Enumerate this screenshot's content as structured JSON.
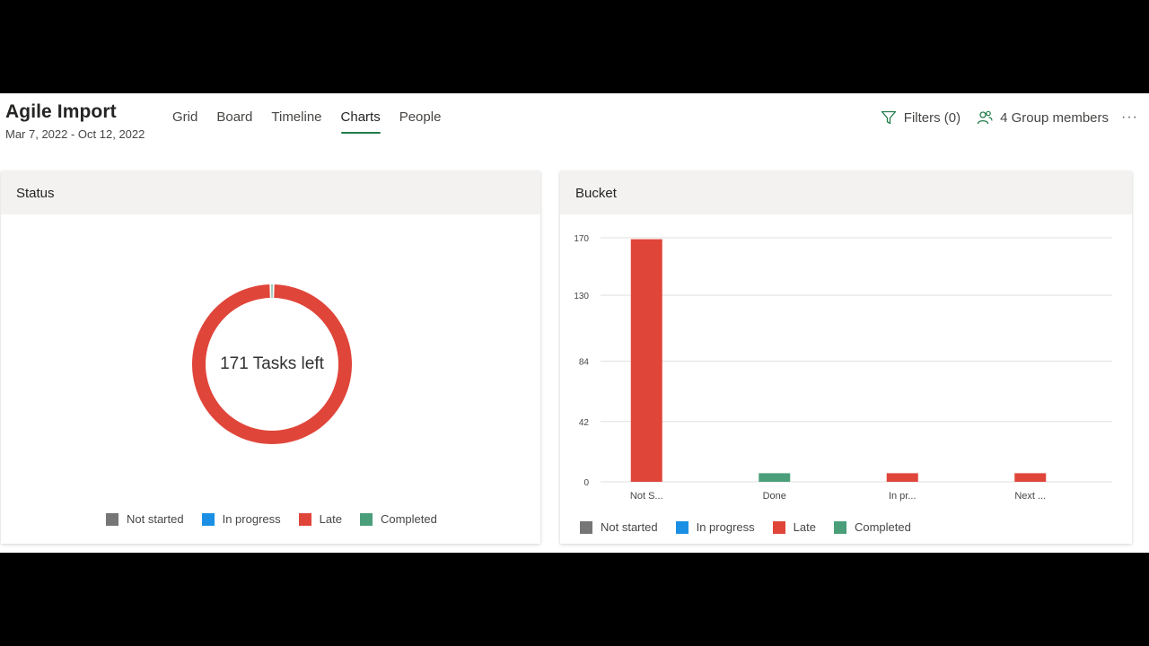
{
  "plan": {
    "title": "Agile Import",
    "dates": "Mar 7, 2022 - Oct 12, 2022"
  },
  "tabs": [
    {
      "label": "Grid"
    },
    {
      "label": "Board"
    },
    {
      "label": "Timeline"
    },
    {
      "label": "Charts",
      "active": true
    },
    {
      "label": "People"
    }
  ],
  "header": {
    "filters_label": "Filters (0)",
    "members_label": "4 Group members",
    "more_label": "···"
  },
  "status_card": {
    "title": "Status",
    "center_text": "171 Tasks left"
  },
  "bucket_card": {
    "title": "Bucket"
  },
  "legend": [
    {
      "label": "Not started",
      "color": "#767676"
    },
    {
      "label": "In progress",
      "color": "#1a8fe3"
    },
    {
      "label": "Late",
      "color": "#e0453a"
    },
    {
      "label": "Completed",
      "color": "#4a9f7a"
    }
  ],
  "chart_data": [
    {
      "type": "pie",
      "categories": [
        "Not started",
        "In progress",
        "Late",
        "Completed"
      ],
      "values": [
        0,
        0,
        171,
        1
      ],
      "colors": [
        "#767676",
        "#1a8fe3",
        "#e0453a",
        "#4a9f7a"
      ],
      "donut": true,
      "center_text": "171 Tasks left",
      "title": "Status"
    },
    {
      "type": "bar",
      "title": "Bucket",
      "categories": [
        "Not S...",
        "Done",
        "In pr...",
        "Next ..."
      ],
      "series": [
        {
          "name": "Not started",
          "color": "#767676",
          "values": [
            0,
            0,
            0,
            0
          ]
        },
        {
          "name": "In progress",
          "color": "#1a8fe3",
          "values": [
            0,
            0,
            0,
            0
          ]
        },
        {
          "name": "Late",
          "color": "#e0453a",
          "values": [
            169,
            0,
            6,
            6
          ]
        },
        {
          "name": "Completed",
          "color": "#4a9f7a",
          "values": [
            0,
            6,
            0,
            0
          ]
        }
      ],
      "yticks": [
        0,
        42,
        84,
        130,
        170
      ],
      "ylim": [
        0,
        170
      ],
      "grid": true
    }
  ]
}
